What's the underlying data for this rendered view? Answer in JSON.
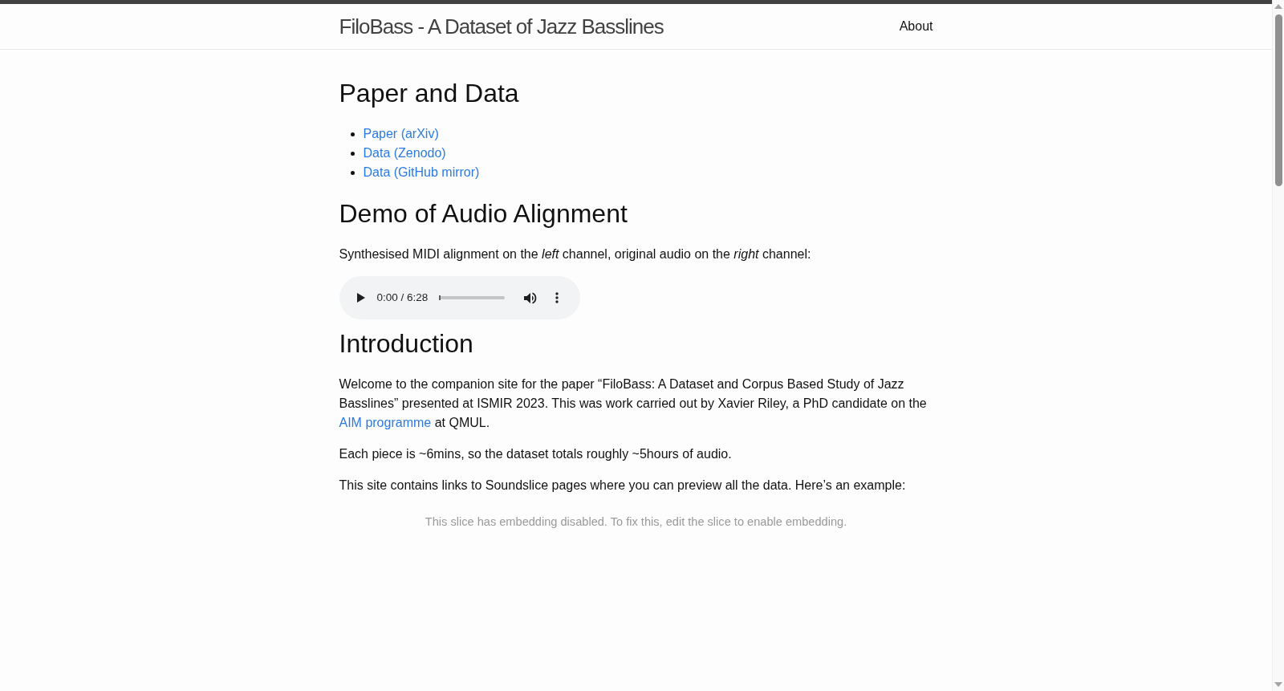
{
  "header": {
    "site_title": "FiloBass - A Dataset of Jazz Basslines",
    "nav_links": [
      "About"
    ]
  },
  "sections": [
    {
      "heading": "Paper and Data",
      "blocks": [
        {
          "kind": "links",
          "items": [
            "Paper (arXiv)",
            "Data (Zenodo)",
            "Data (GitHub mirror)"
          ]
        }
      ]
    },
    {
      "heading": "Demo of Audio Alignment",
      "blocks": [
        {
          "kind": "paragraph",
          "text": "Synthesised MIDI alignment on the *left* channel, original audio on the *right* channel:"
        },
        {
          "kind": "audio",
          "time": "0:00 / 6:28",
          "level": 0
        }
      ]
    },
    {
      "heading": "Introduction",
      "blocks": [
        {
          "kind": "paragraph",
          "segments": [
            {
              "kind": "text",
              "text": "Welcome to the companion site for the paper “FiloBass: A Dataset and Corpus Based Study of Jazz Basslines” presented at ISMIR 2023. This was work carried out by Xavier Riley, a PhD candidate on the "
            },
            {
              "kind": "link",
              "text": "AIM programme"
            },
            {
              "kind": "text",
              "text": " at QMUL."
            }
          ]
        },
        {
          "kind": "paragraph",
          "text": "Each piece is ~6mins, so the dataset totals roughly ~5hours of audio."
        },
        {
          "kind": "paragraph",
          "text": "This site contains links to Soundslice pages where you can preview all the data. Here’s an example:"
        },
        {
          "kind": "embed",
          "message": "This slice has embedding disabled. To fix this, edit the slice to enable embedding."
        }
      ]
    }
  ]
}
